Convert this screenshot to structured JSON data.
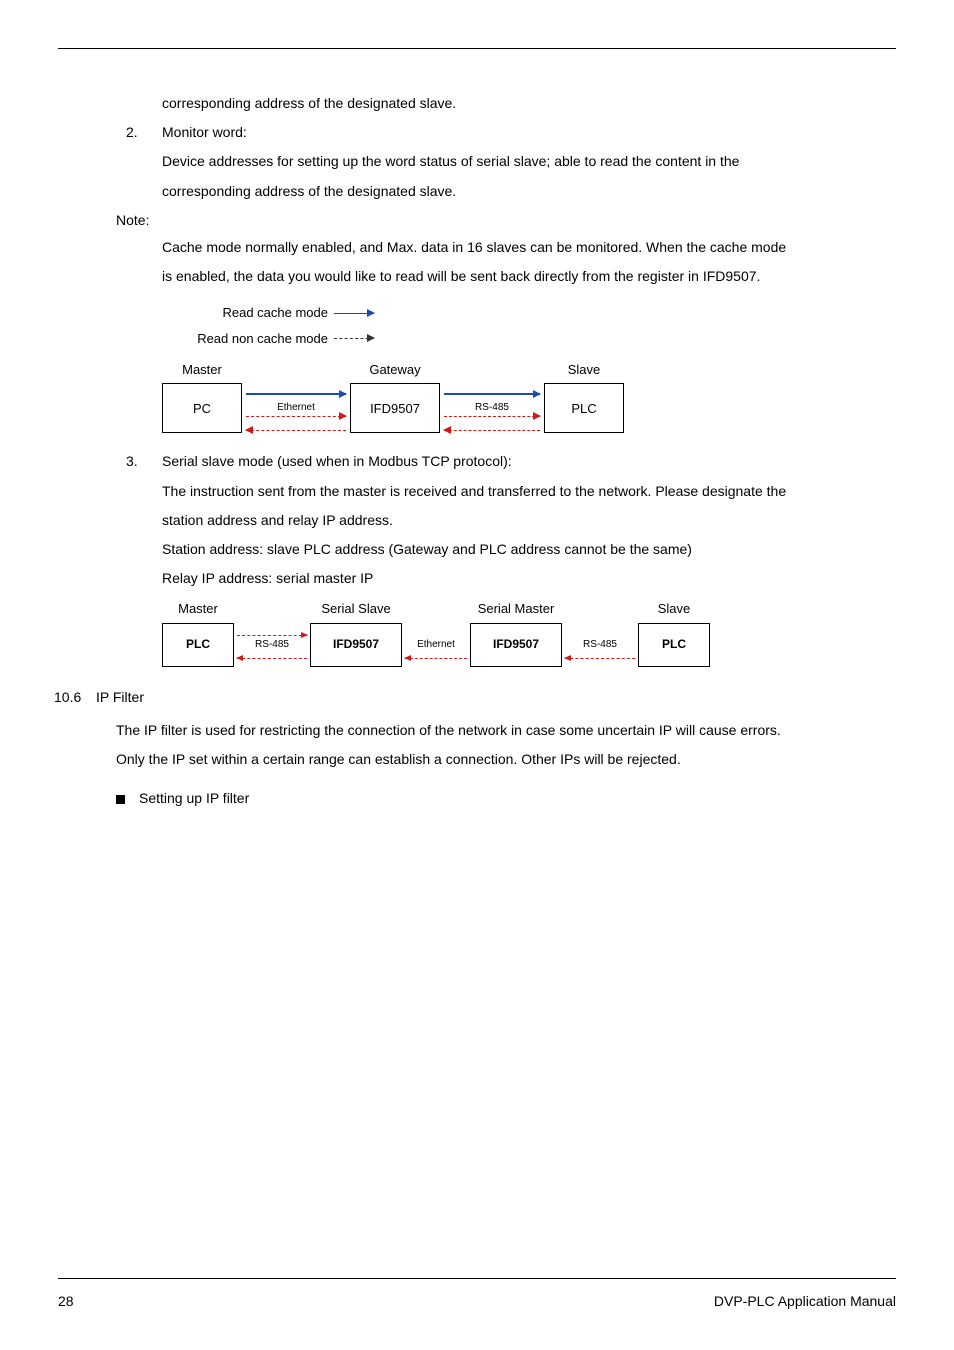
{
  "body": {
    "line1": "corresponding address of the designated slave.",
    "item2_num": "2.",
    "item2_title": "Monitor word:",
    "item2_p1": "Device addresses for setting up the word status of serial slave; able to read the content in the",
    "item2_p2": "corresponding address of the designated slave.",
    "note_label": "Note:",
    "note_p1": "Cache mode normally enabled, and Max. data in 16 slaves can be monitored. When the cache mode",
    "note_p2": "is enabled, the data you would like to read will be sent back directly from the register in IFD9507."
  },
  "diagram1": {
    "legend1": "Read cache mode",
    "legend2": "Read non cache mode",
    "col_master": "Master",
    "col_gateway": "Gateway",
    "col_slave": "Slave",
    "box_pc": "PC",
    "box_ifd": "IFD9507",
    "box_plc": "PLC",
    "conn_eth": "Ethernet",
    "conn_rs": "RS-485"
  },
  "item3": {
    "num": "3.",
    "title": "Serial slave mode (used when in Modbus TCP protocol):",
    "p1": "The instruction sent from the master is received and transferred to the network. Please designate the",
    "p2": "station address and relay IP address.",
    "p3": "Station address: slave PLC address (Gateway and PLC address cannot be the same)",
    "p4": "Relay IP address: serial master IP"
  },
  "diagram2": {
    "h_master": "Master",
    "h_sslave": "Serial Slave",
    "h_smaster": "Serial Master",
    "h_slave": "Slave",
    "box_plc": "PLC",
    "box_ifd": "IFD9507",
    "conn_rs": "RS-485",
    "conn_eth": "Ethernet"
  },
  "sec": {
    "num": "10.6",
    "title": "IP Filter",
    "p1": "The IP filter is used for restricting the connection of the network in case some uncertain IP will cause errors.",
    "p2": "Only the IP set within a certain range can establish a connection. Other IPs will be rejected.",
    "bullet": "Setting up IP filter"
  },
  "footer": {
    "page": "28",
    "manual": "DVP-PLC  Application  Manual"
  }
}
